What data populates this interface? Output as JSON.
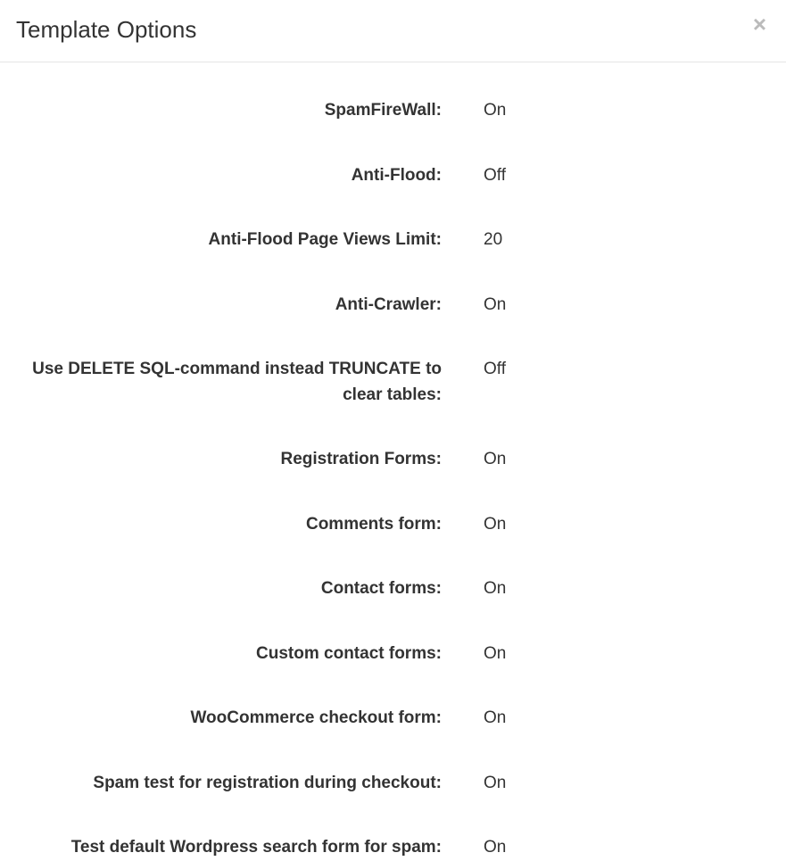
{
  "header": {
    "title": "Template Options"
  },
  "options": [
    {
      "label": "SpamFireWall:",
      "value": "On"
    },
    {
      "label": "Anti-Flood:",
      "value": "Off"
    },
    {
      "label": "Anti-Flood Page Views Limit:",
      "value": "20"
    },
    {
      "label": "Anti-Crawler:",
      "value": "On"
    },
    {
      "label": "Use DELETE SQL-command instead TRUNCATE to clear tables:",
      "value": "Off"
    },
    {
      "label": "Registration Forms:",
      "value": "On"
    },
    {
      "label": "Comments form:",
      "value": "On"
    },
    {
      "label": "Contact forms:",
      "value": "On"
    },
    {
      "label": "Custom contact forms:",
      "value": "On"
    },
    {
      "label": "WooCommerce checkout form:",
      "value": "On"
    },
    {
      "label": "Spam test for registration during checkout:",
      "value": "On"
    },
    {
      "label": "Test default Wordpress search form for spam:",
      "value": "On"
    }
  ]
}
